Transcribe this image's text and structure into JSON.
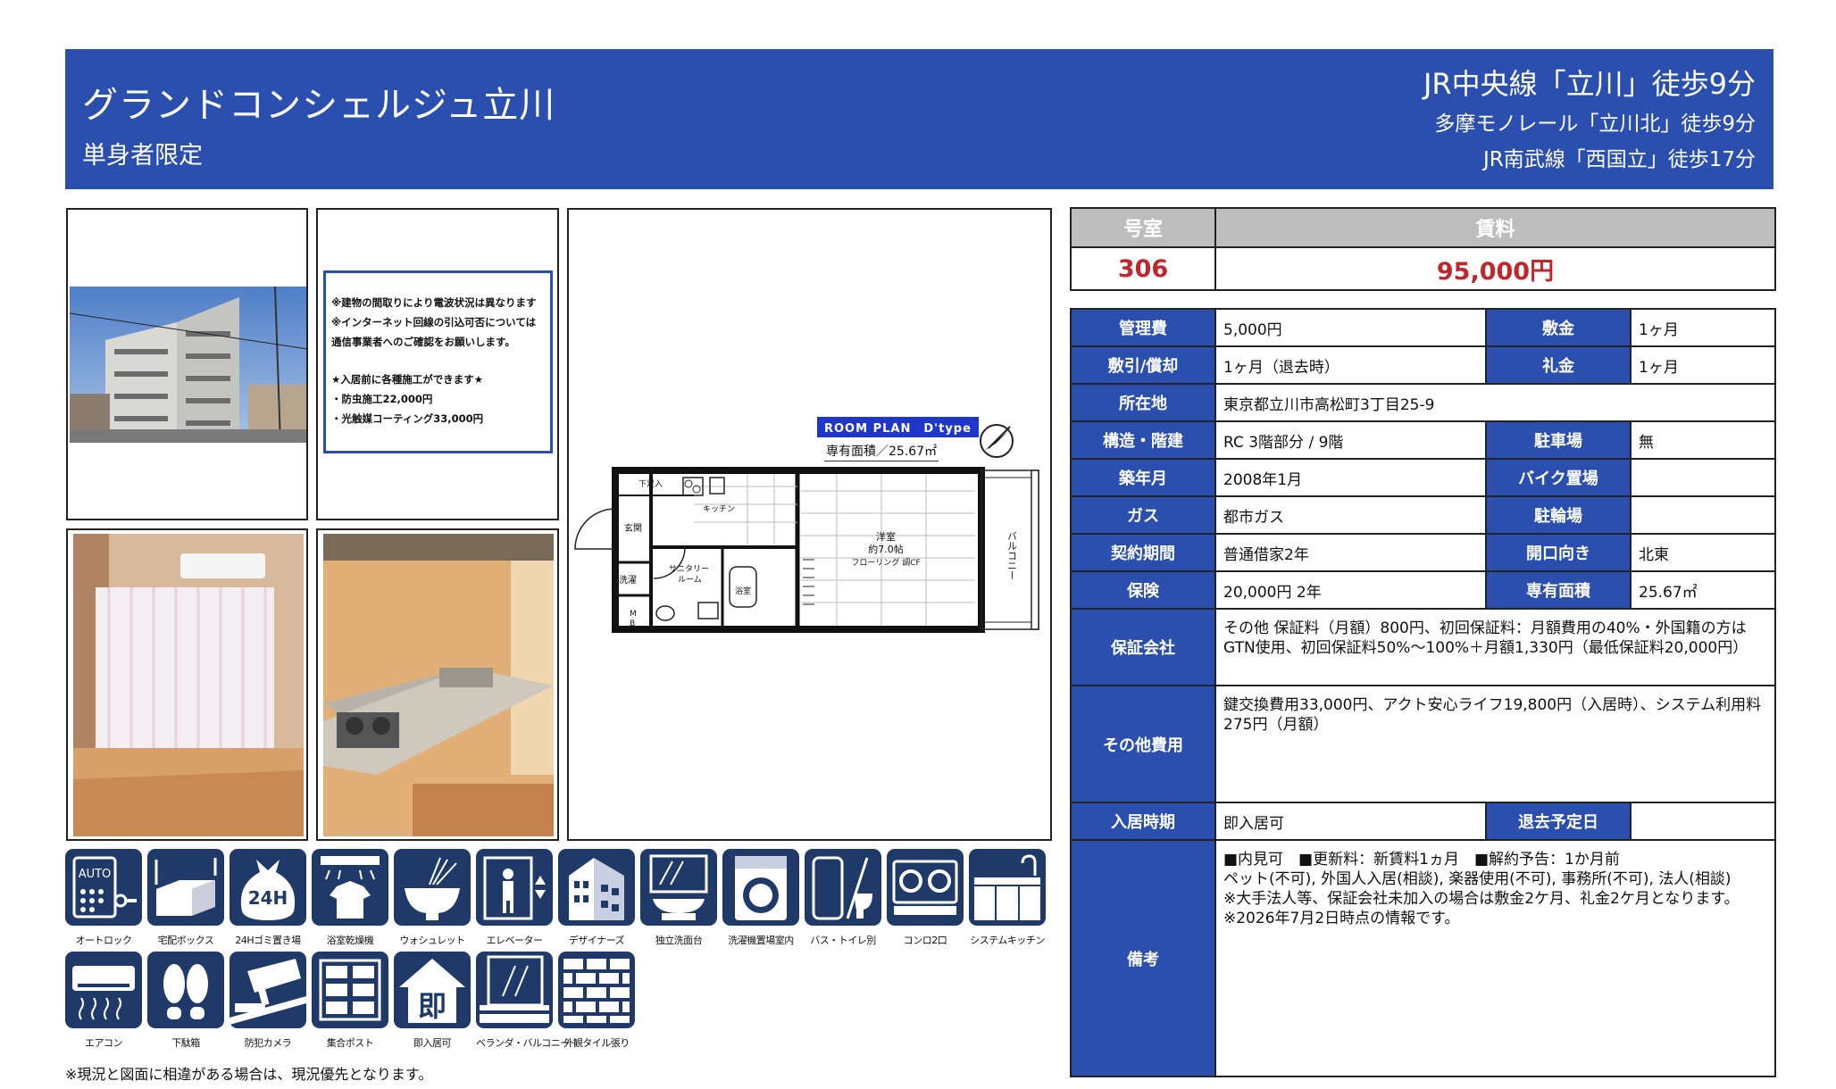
{
  "header": {
    "property_name": "グランドコンシェルジュ立川",
    "subtitle": "単身者限定",
    "station_1": "JR中央線「立川」徒歩9分",
    "station_2": "多摩モノレール「立川北」徒歩9分",
    "station_3": "JR南武線「西国立」徒歩17分"
  },
  "notice": {
    "lines": [
      "※建物の間取りにより電波状況は異なります",
      "※インターネット回線の引込可否については",
      "通信事業者へのご確認をお願いします。",
      "",
      "★入居前に各種施工ができます★",
      "・防虫施工22,000円",
      "・光触媒コーティング33,000円"
    ]
  },
  "floor_plan": {
    "badge": "ROOM PLAN　D'type",
    "area_label": "専有面積／25.67㎡",
    "rooms": {
      "shoebox": "下足入",
      "kitchen": "キッチン",
      "entrance": "玄関",
      "laundry": "洗濯",
      "sanitary": "サニタリー\nルーム",
      "bath": "浴室",
      "western_1": "洋室",
      "western_2": "約7.0帖",
      "western_3": "フローリング 調CF",
      "balcony": "バルコニー",
      "mb": "M\nB"
    }
  },
  "amenities_row1": [
    "オートロック",
    "宅配ボックス",
    "24Hゴミ置き場",
    "浴室乾燥機",
    "ウォシュレット",
    "エレベーター",
    "デザイナーズ",
    "独立洗面台",
    "洗濯機置場室内",
    "バス・トイレ別",
    "コンロ2口",
    "システムキッチン"
  ],
  "amenities_row2": [
    "エアコン",
    "下駄箱",
    "防犯カメラ",
    "集合ポスト",
    "即入居可",
    "ベランダ・バルコニー",
    "外観タイル張り"
  ],
  "amenity_icon_text": {
    "auto": "AUTO",
    "h24": "24H",
    "immediate": "即"
  },
  "footer_note": "※現況と図面に相違がある場合は、現況優先となります。",
  "rent_table": {
    "room_header": "号室",
    "rent_header": "賃料",
    "room": "306",
    "rent": "95,000円"
  },
  "info": {
    "mgmt_fee_label": "管理費",
    "mgmt_fee": "5,000円",
    "deposit_label": "敷金",
    "deposit": "1ヶ月",
    "shikibiki_label": "敷引/償却",
    "shikibiki": "1ヶ月（退去時）",
    "key_money_label": "礼金",
    "key_money": "1ヶ月",
    "address_label": "所在地",
    "address": "東京都立川市高松町3丁目25-9",
    "structure_label": "構造・階建",
    "structure": "RC 3階部分 / 9階",
    "parking_label": "駐車場",
    "parking": "無",
    "built_label": "築年月",
    "built": "2008年1月",
    "bike_label": "バイク置場",
    "bike": "",
    "gas_label": "ガス",
    "gas": "都市ガス",
    "bicycle_label": "駐輪場",
    "bicycle": "",
    "contract_label": "契約期間",
    "contract": "普通借家2年",
    "direction_label": "開口向き",
    "direction": "北東",
    "insurance_label": "保険",
    "insurance": "20,000円 2年",
    "area_label": "専有面積",
    "area": "25.67㎡",
    "guarantor_label": "保証会社",
    "guarantor": "その他 保証料（月額）800円、初回保証料：月額費用の40%・外国籍の方はGTN使用、初回保証料50%～100%＋月額1,330円（最低保証料20,000円）",
    "other_fees_label": "その他費用",
    "other_fees": "鍵交換費用33,000円、アクト安心ライフ19,800円（入居時）、システム利用料275円（月額）",
    "move_in_label": "入居時期",
    "move_in": "即入居可",
    "move_out_label": "退去予定日",
    "move_out": "",
    "remarks_label": "備考",
    "remarks": [
      "■内見可　■更新料：新賃料1ヵ月　■解約予告：1か月前",
      "ペット(不可), 外国人入居(相談), 楽器使用(不可), 事務所(不可), 法人(相談)",
      "※大手法人等、保証会社未加入の場合は敷金2ケ月、礼金2ケ月となります。",
      "※2026年7月2日時点の情報です。"
    ]
  },
  "colors": {
    "header_blue": "#2b4fae",
    "icon_navy": "#1f3a68",
    "rent_red": "#c0262c",
    "gray_header": "#bdbdbd"
  }
}
